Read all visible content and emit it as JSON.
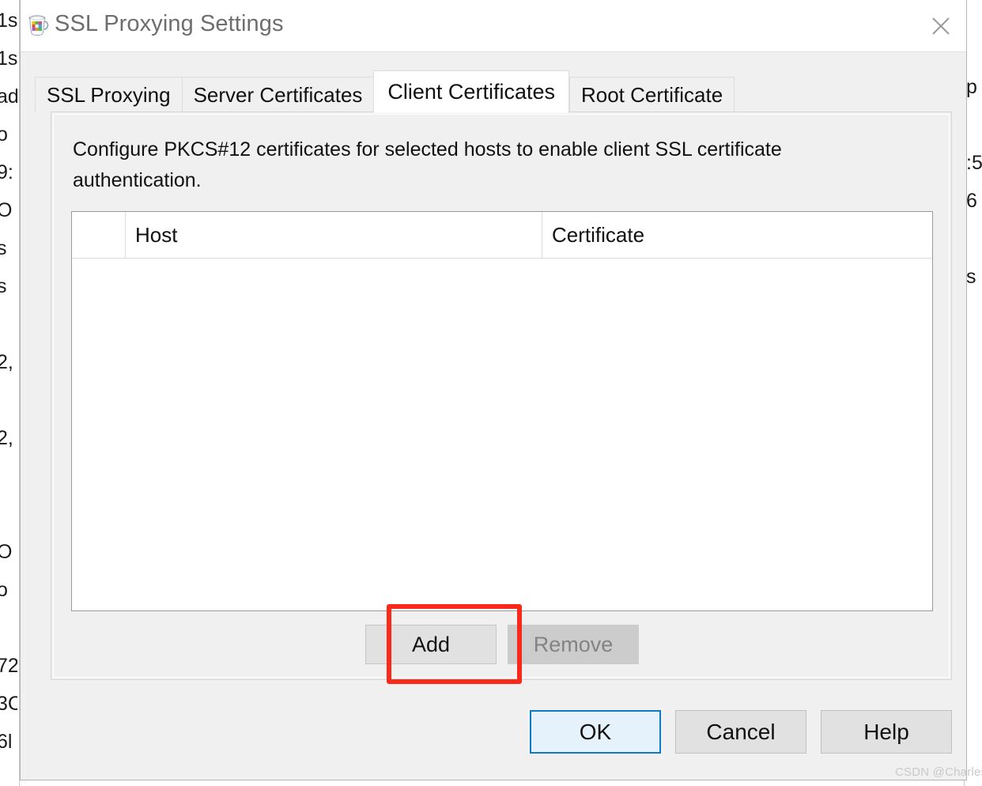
{
  "window": {
    "title": "SSL Proxying Settings",
    "app_icon": "charles-jug-icon",
    "close_icon": "close-icon"
  },
  "tabs": [
    {
      "label": "SSL Proxying",
      "active": false
    },
    {
      "label": "Server Certificates",
      "active": false
    },
    {
      "label": "Client Certificates",
      "active": true
    },
    {
      "label": "Root Certificate",
      "active": false
    }
  ],
  "panel": {
    "description": "Configure PKCS#12 certificates for selected hosts to enable client SSL certificate authentication."
  },
  "table": {
    "columns": [
      "",
      "Host",
      "Certificate"
    ],
    "rows": []
  },
  "list_actions": {
    "add_label": "Add",
    "remove_label": "Remove"
  },
  "footer": {
    "ok_label": "OK",
    "cancel_label": "Cancel",
    "help_label": "Help"
  },
  "annotation": {
    "highlight_target": "add-button",
    "highlight_color": "#fa2a1a"
  },
  "watermark": {
    "text": "CSDN @Charles-L"
  },
  "background_window": {
    "left_fragments": "1s\n1s\nad\no\n9:\nO\ns\ns\n\n2,\n\n2,\n\n\nO\no\n\n72\n3C\n6l",
    "right_fragments": "p\n\n:5\n6\n\ns"
  },
  "colors": {
    "dialog_bg": "#f0f0f0",
    "titlebar_bg": "#ffffff",
    "accent_default_button": "#0d7bc4",
    "annotation_red": "#fa2a1a",
    "disabled_text": "#838383"
  }
}
